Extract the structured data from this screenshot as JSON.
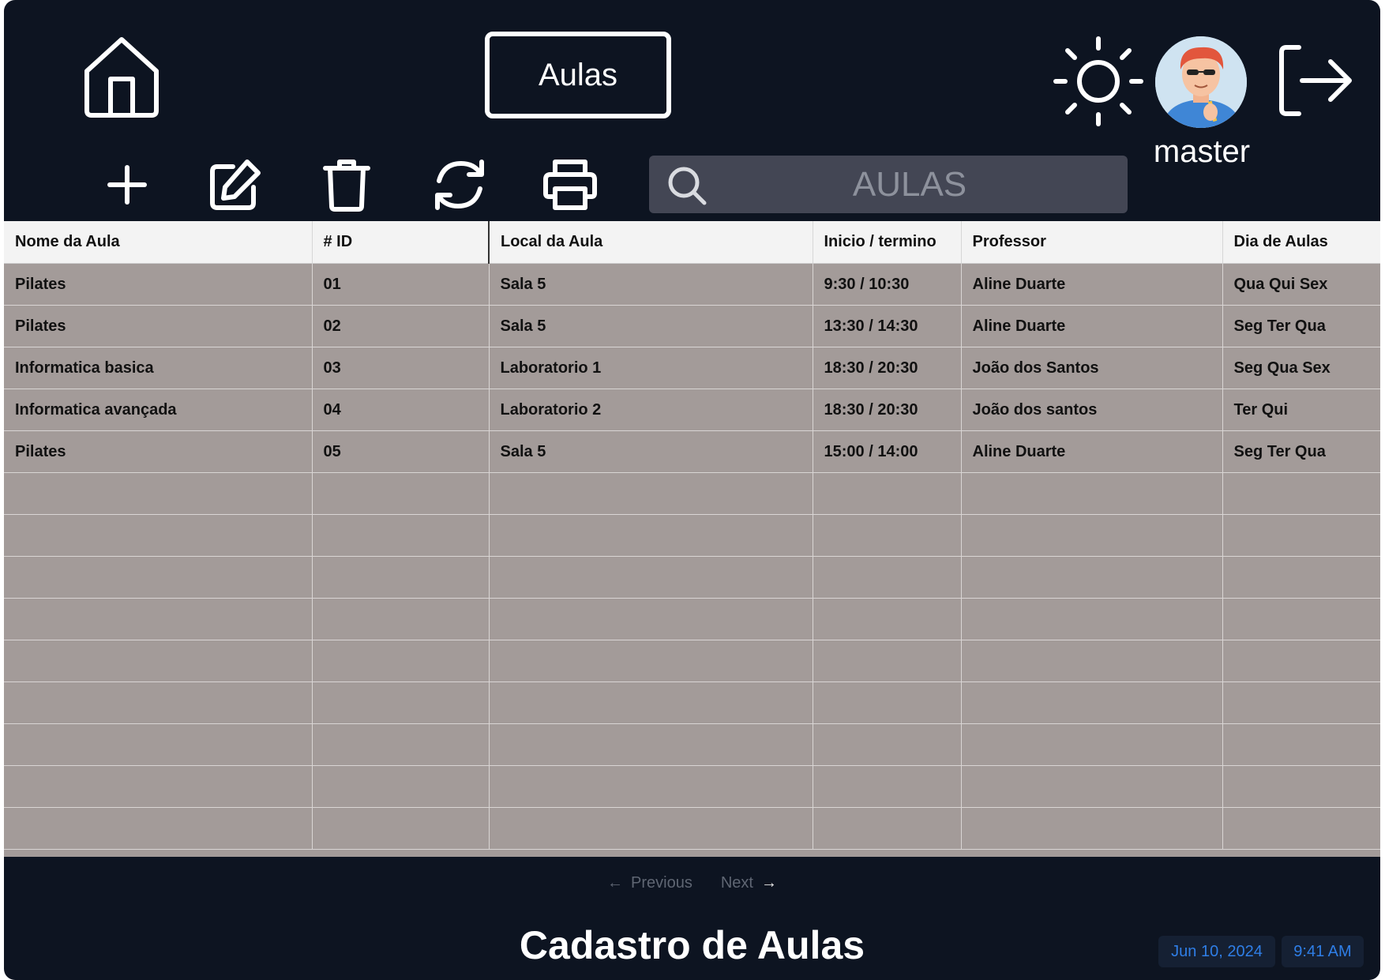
{
  "header": {
    "title": "Aulas",
    "username": "master",
    "icons": {
      "home": "home-icon",
      "theme": "sun-icon",
      "logout": "logout-icon",
      "avatar": "user-avatar"
    }
  },
  "toolbar": {
    "icons": [
      "plus-icon",
      "edit-icon",
      "trash-icon",
      "refresh-icon",
      "printer-icon"
    ],
    "search_placeholder": "AULAS"
  },
  "table": {
    "columns": [
      "Nome da Aula",
      "# ID",
      "Local da Aula",
      "Inicio / termino",
      "Professor",
      "Dia de Aulas"
    ],
    "rows": [
      [
        "Pilates",
        "01",
        "Sala 5",
        "9:30 / 10:30",
        "Aline Duarte",
        "Qua Qui Sex"
      ],
      [
        "Pilates",
        "02",
        "Sala 5",
        "13:30 / 14:30",
        "Aline Duarte",
        "Seg Ter Qua"
      ],
      [
        "Informatica basica",
        "03",
        "Laboratorio 1",
        "18:30 / 20:30",
        "João dos Santos",
        "Seg Qua Sex"
      ],
      [
        "Informatica avançada",
        "04",
        "Laboratorio 2",
        "18:30 / 20:30",
        "João dos santos",
        "Ter Qui"
      ],
      [
        "Pilates",
        "05",
        "Sala 5",
        "15:00 / 14:00",
        "Aline Duarte",
        "Seg Ter Qua"
      ],
      [
        "",
        "",
        "",
        "",
        "",
        ""
      ],
      [
        "",
        "",
        "",
        "",
        "",
        ""
      ],
      [
        "",
        "",
        "",
        "",
        "",
        ""
      ],
      [
        "",
        "",
        "",
        "",
        "",
        ""
      ],
      [
        "",
        "",
        "",
        "",
        "",
        ""
      ],
      [
        "",
        "",
        "",
        "",
        "",
        ""
      ],
      [
        "",
        "",
        "",
        "",
        "",
        ""
      ],
      [
        "",
        "",
        "",
        "",
        "",
        ""
      ],
      [
        "",
        "",
        "",
        "",
        "",
        ""
      ]
    ]
  },
  "pagination": {
    "previous": "Previous",
    "next": "Next"
  },
  "footer": {
    "title": "Cadastro de Aulas",
    "date": "Jun 10, 2024",
    "time": "9:41 AM"
  },
  "colors": {
    "background": "#0d1421",
    "table_row": "#a39b99",
    "header_row": "#f3f3f3",
    "chip_text": "#2f7ee6"
  }
}
